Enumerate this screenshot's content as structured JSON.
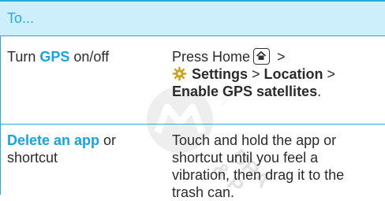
{
  "header": {
    "title": "To..."
  },
  "rows": [
    {
      "left_highlight": "GPS",
      "left_before": "Turn ",
      "left_after": " on/off",
      "right": {
        "line1": "Press Home",
        "line1_suffix": " >",
        "settings": "Settings",
        "sep1": " > ",
        "location": "Location",
        "sep2": " >",
        "enable": "Enable GPS satellites",
        "period": "."
      }
    },
    {
      "left_highlight": "Delete an app",
      "left_after": " or",
      "left_line2": "shortcut",
      "right_lines": [
        "Touch and hold the app or",
        "shortcut until you feel a",
        "vibration, then drag it to the",
        "trash can."
      ]
    }
  ],
  "icons": {
    "home_key": "home-key-icon",
    "settings": "settings-gear-icon",
    "watermark": "motorola-logo-watermark"
  },
  "watermark_text": [
    "DRA",
    "& P"
  ],
  "colors": {
    "accent": "#1aa3db",
    "header_bg": "#cdeefb",
    "rule": "#2aa9dc",
    "text": "#2b2b2b"
  }
}
